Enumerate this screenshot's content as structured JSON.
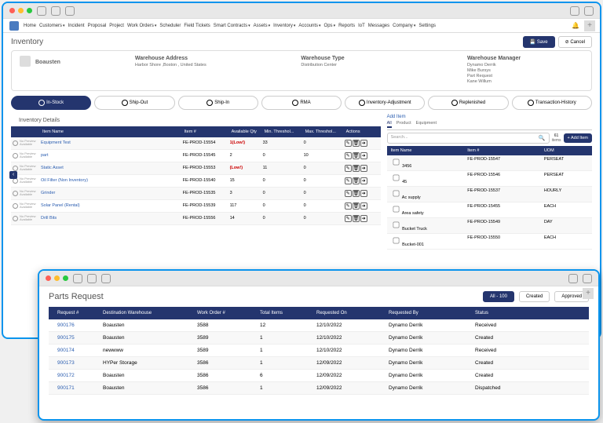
{
  "nav": [
    "Home",
    "Customers",
    "Incident",
    "Proposal",
    "Project",
    "Work Orders",
    "Scheduler",
    "Field Tickets",
    "Smart Contracts",
    "Assets",
    "Inventory",
    "Accounts",
    "Ops",
    "Reports",
    "IoT",
    "Messages",
    "Company",
    "Settings"
  ],
  "navdrop": [
    false,
    true,
    false,
    false,
    false,
    true,
    false,
    false,
    true,
    true,
    true,
    true,
    true,
    false,
    false,
    false,
    true,
    false
  ],
  "page": {
    "title": "Inventory",
    "save": "Save",
    "cancel": "Cancel"
  },
  "wh": {
    "name": "Boausten",
    "addr_h": "Warehouse Address",
    "addr": "Harbor Shore ,Boston , United States",
    "type_h": "Warehouse Type",
    "type": "Distribution Center",
    "mgr_h": "Warehouse Manager",
    "mgrs": [
      "Dynamo Derrik",
      "Mike Bursys",
      "Part Request",
      "Kane Willum"
    ]
  },
  "tabs": [
    "In-Stock",
    "Ship-Out",
    "Ship-In",
    "RMA",
    "Inventory-Adjustment",
    "Replenished",
    "Transaction-History"
  ],
  "sec": "Inventory Details",
  "th": [
    "",
    "Item Name",
    "Item #",
    "Available Qty",
    "Min. Threshol...",
    "Max. Threshol...",
    "Actions"
  ],
  "rows": [
    {
      "name": "Equipment Test",
      "num": "FE-PROD-15554",
      "qty": "1(Low!)",
      "low": true,
      "min": "33",
      "max": "0"
    },
    {
      "name": "part",
      "num": "FE-PROD-15545",
      "qty": "2",
      "low": false,
      "min": "0",
      "max": "10"
    },
    {
      "name": "Static Asset",
      "num": "FE-PROD-15553",
      "qty": "(Low!)",
      "low": true,
      "min": "11",
      "max": "0"
    },
    {
      "name": "Oil Filter (Non Inventory)",
      "num": "FE-PROD-15540",
      "qty": "15",
      "low": false,
      "min": "0",
      "max": "0"
    },
    {
      "name": "Grinder",
      "num": "FE-PROD-15535",
      "qty": "3",
      "low": false,
      "min": "0",
      "max": "0"
    },
    {
      "name": "Solar Panel (Rental)",
      "num": "FE-PROD-15539",
      "qty": "117",
      "low": false,
      "min": "0",
      "max": "0"
    },
    {
      "name": "Drill Bits",
      "num": "FE-PROD-15556",
      "qty": "14",
      "low": false,
      "min": "0",
      "max": "0"
    }
  ],
  "add": {
    "h": "Add Item",
    "tabs": [
      "All",
      "Product",
      "Equipment"
    ],
    "search": "Search...",
    "count": "61",
    "count_l": "items",
    "btn": "+ Add Item",
    "th": [
      "Item Name",
      "Item #",
      "UOM"
    ],
    "rows": [
      {
        "n": "3456",
        "i": "FE-PROD-15547",
        "u": "PERSEAT"
      },
      {
        "n": "45",
        "i": "FE-PROD-15546",
        "u": "PERSEAT"
      },
      {
        "n": "Ac supply",
        "i": "FE-PROD-15537",
        "u": "HOURLY"
      },
      {
        "n": "Area safety",
        "i": "FE-PROD-15455",
        "u": "EACH"
      },
      {
        "n": "Bucket Truck",
        "i": "FE-PROD-15549",
        "u": "DAY"
      },
      {
        "n": "Bucket-001",
        "i": "FE-PROD-15550",
        "u": "EACH"
      }
    ]
  },
  "pr": {
    "title": "Parts Request",
    "filters": [
      "All - 100",
      "Created",
      "Approved"
    ],
    "th": [
      "Request #",
      "Destination Warehouse",
      "Work Order #",
      "Total Items",
      "Requested On",
      "Requested By",
      "Status"
    ],
    "rows": [
      {
        "r": "900176",
        "d": "Boausten",
        "w": "3588",
        "t": "12",
        "on": "12/10/2022",
        "by": "Dynamo Derrik",
        "s": "Received"
      },
      {
        "r": "900175",
        "d": "Boausten",
        "w": "3589",
        "t": "1",
        "on": "12/10/2022",
        "by": "Dynamo Derrik",
        "s": "Created"
      },
      {
        "r": "900174",
        "d": "newwww",
        "w": "3589",
        "t": "1",
        "on": "12/10/2022",
        "by": "Dynamo Derrik",
        "s": "Received"
      },
      {
        "r": "900173",
        "d": "HYPer Storage",
        "w": "3586",
        "t": "1",
        "on": "12/09/2022",
        "by": "Dynamo Derrik",
        "s": "Created"
      },
      {
        "r": "900172",
        "d": "Boausten",
        "w": "3586",
        "t": "6",
        "on": "12/09/2022",
        "by": "Dynamo Derrik",
        "s": "Created"
      },
      {
        "r": "900171",
        "d": "Boausten",
        "w": "3586",
        "t": "1",
        "on": "12/09/2022",
        "by": "Dynamo Derrik",
        "s": "Dispatched"
      }
    ]
  }
}
